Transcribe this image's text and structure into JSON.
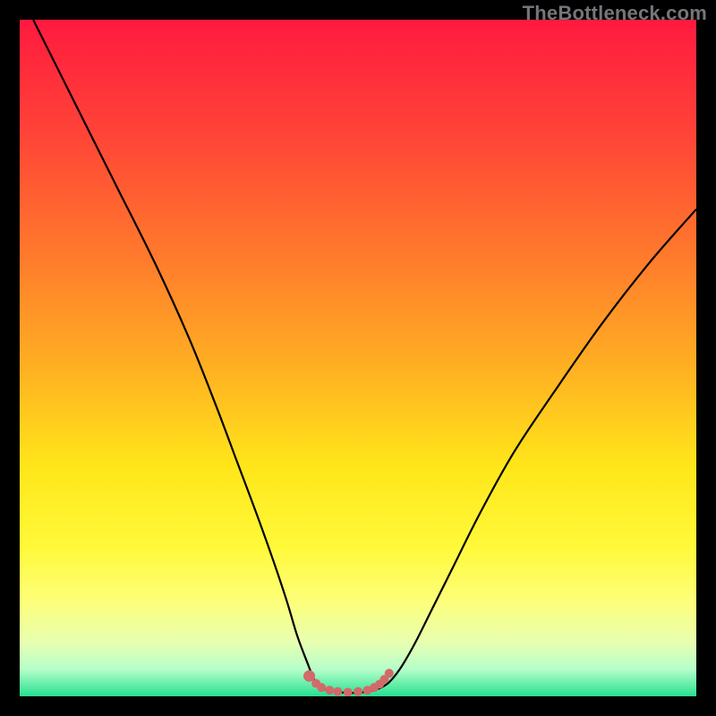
{
  "watermark": "TheBottleneck.com",
  "palette": {
    "bg": "#000000",
    "curve": "#000000",
    "marker": "#d26a6a",
    "gradient_stops": [
      {
        "pos": 0.0,
        "color": "#ff1a3f"
      },
      {
        "pos": 0.17,
        "color": "#ff4437"
      },
      {
        "pos": 0.35,
        "color": "#ff7a2c"
      },
      {
        "pos": 0.52,
        "color": "#ffb222"
      },
      {
        "pos": 0.66,
        "color": "#ffe61a"
      },
      {
        "pos": 0.78,
        "color": "#fff93a"
      },
      {
        "pos": 0.86,
        "color": "#fdff7a"
      },
      {
        "pos": 0.92,
        "color": "#e8ffb0"
      },
      {
        "pos": 0.96,
        "color": "#b6ffca"
      },
      {
        "pos": 1.0,
        "color": "#26e18f"
      }
    ]
  },
  "chart_data": {
    "type": "line",
    "title": "",
    "xlabel": "",
    "ylabel": "",
    "xlim": [
      0,
      100
    ],
    "ylim": [
      0,
      100
    ],
    "grid": false,
    "note": "Axis values are estimated from pixel positions; the figure shows no tick labels.",
    "series": [
      {
        "name": "curve",
        "x": [
          2,
          8,
          14,
          20,
          25,
          29,
          32,
          35,
          37.5,
          39.5,
          41,
          42.5,
          43.5,
          44.2,
          46,
          49,
          52,
          53.8,
          55,
          56.5,
          58.5,
          61,
          64,
          68,
          73,
          79,
          86,
          93,
          100
        ],
        "y": [
          100,
          88,
          76,
          64,
          53,
          43,
          35,
          27,
          20,
          14,
          9,
          5,
          2.5,
          1.5,
          0.8,
          0.5,
          0.8,
          1.5,
          2.5,
          4.5,
          8,
          13,
          19,
          27,
          36,
          45,
          55,
          64,
          72
        ]
      }
    ],
    "markers": {
      "name": "highlight-dots",
      "x": [
        42.8,
        43.8,
        44.6,
        45.8,
        47.0,
        48.5,
        50.0,
        51.4,
        52.4,
        53.2,
        53.9,
        54.6
      ],
      "y": [
        3.0,
        1.9,
        1.3,
        0.9,
        0.7,
        0.6,
        0.7,
        0.9,
        1.3,
        1.8,
        2.5,
        3.4
      ],
      "r_first": 6.5,
      "r_rest": 5.0
    }
  }
}
